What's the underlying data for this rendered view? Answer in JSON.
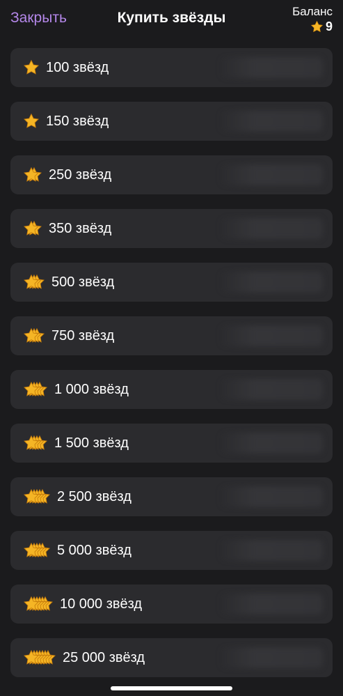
{
  "header": {
    "close_label": "Закрыть",
    "title": "Купить звёзды",
    "balance_label": "Баланс",
    "balance_value": "9",
    "balance_icon": "star-icon"
  },
  "colors": {
    "background": "#1b1b1d",
    "row_background": "#2b2b2e",
    "accent": "#b487e9",
    "star": "#f5b525"
  },
  "packages": [
    {
      "label": "100 звёзд",
      "star_count": 1
    },
    {
      "label": "150 звёзд",
      "star_count": 1
    },
    {
      "label": "250 звёзд",
      "star_count": 2
    },
    {
      "label": "350 звёзд",
      "star_count": 2
    },
    {
      "label": "500 звёзд",
      "star_count": 3
    },
    {
      "label": "750 звёзд",
      "star_count": 3
    },
    {
      "label": "1 000 звёзд",
      "star_count": 4
    },
    {
      "label": "1 500 звёзд",
      "star_count": 4
    },
    {
      "label": "2 500 звёзд",
      "star_count": 5
    },
    {
      "label": "5 000 звёзд",
      "star_count": 5
    },
    {
      "label": "10 000 звёзд",
      "star_count": 6
    },
    {
      "label": "25 000 звёзд",
      "star_count": 7
    }
  ]
}
